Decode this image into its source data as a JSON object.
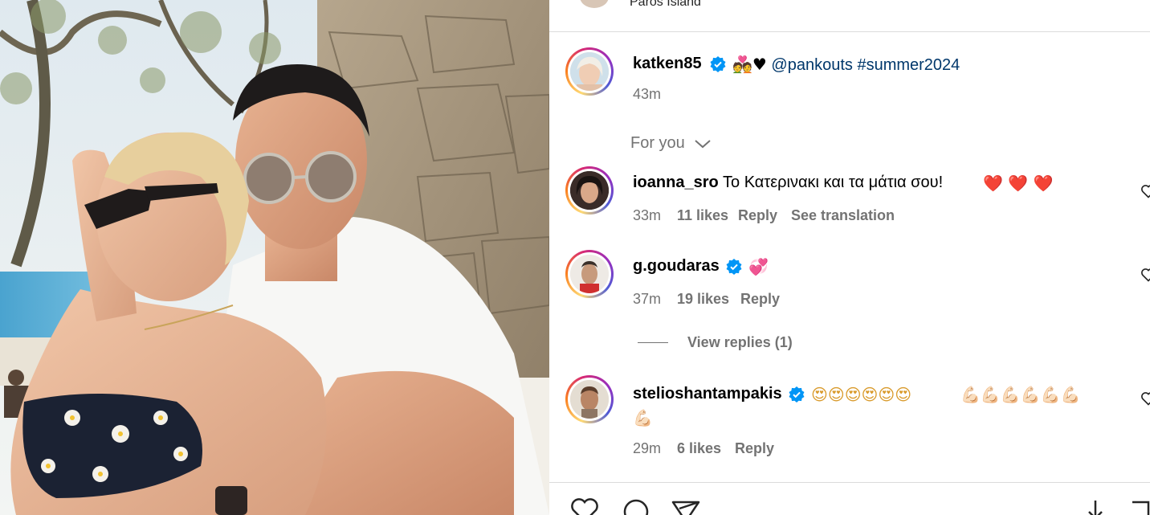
{
  "header": {
    "location": "Paros Island"
  },
  "caption": {
    "username": "katken85",
    "emoji": "💑♥",
    "mention": "@pankouts",
    "hashtag": "#summer2024",
    "time": "43m"
  },
  "sort": {
    "label": "For you"
  },
  "comments": [
    {
      "username": "ioanna_sro",
      "text": "Το Κατερινακι και τα μάτια σου!",
      "emoji": "❤️  ❤️ ❤️",
      "time": "33m",
      "likes": "11 likes",
      "reply": "Reply",
      "translate": "See translation"
    },
    {
      "username": "g.goudaras",
      "emoji": "💞",
      "time": "37m",
      "likes": "19 likes",
      "reply": "Reply",
      "view_replies": "View replies (1)"
    },
    {
      "username": "stelioshantampakis",
      "emoji": "😍😍😍😍😍😍",
      "emoji2": "💪🏻💪🏻💪🏻💪🏻💪🏻💪🏻",
      "emoji3": "💪🏻",
      "time": "29m",
      "likes": "6 likes",
      "reply": "Reply"
    }
  ],
  "colors": {
    "verified": "#0095f6",
    "meta": "#737373",
    "mention": "#00376b",
    "divider": "#dbdbdb"
  },
  "icons": [
    "heart-icon",
    "comment-icon",
    "share-icon",
    "download-icon",
    "save-icon",
    "chevron-down-icon",
    "verified-badge-icon"
  ]
}
